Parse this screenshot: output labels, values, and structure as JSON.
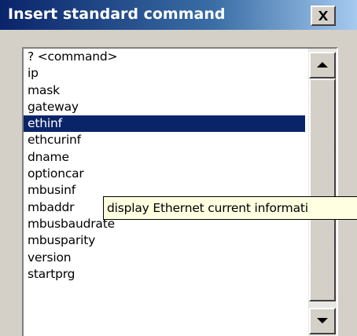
{
  "window": {
    "title": "Insert standard command",
    "close_label": "Close"
  },
  "list": {
    "items": [
      "? <command>",
      "ip",
      "mask",
      "gateway",
      "ethinf",
      "ethcurinf",
      "dname",
      "optioncar",
      "mbusinf",
      "mbaddr",
      "mbusbaudrate",
      "mbusparity",
      "version",
      "startprg"
    ],
    "selected_index": 4
  },
  "tooltip": {
    "text": "display Ethernet current informati"
  },
  "icons": {
    "close": "close-icon",
    "scroll_up": "up-arrow-icon",
    "scroll_down": "down-arrow-icon"
  },
  "colors": {
    "title_bar": "#0a246a",
    "selection": "#0a246a",
    "tooltip_bg": "#ffffe1",
    "face": "#d4d0c8"
  }
}
